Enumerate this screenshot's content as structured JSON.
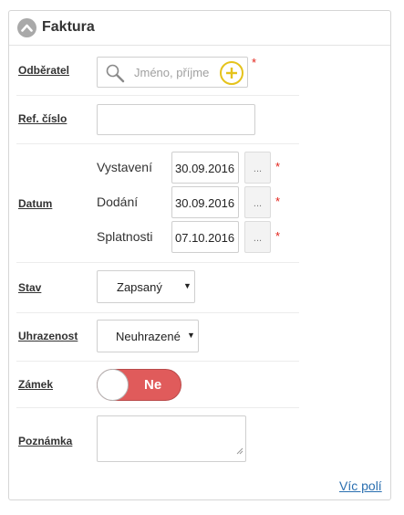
{
  "panel": {
    "title": "Faktura",
    "more_link": "Víc polí"
  },
  "fields": {
    "customer": {
      "label": "Odběratel",
      "placeholder": "Jméno, příjme",
      "required": "*"
    },
    "ref_number": {
      "label": "Ref. číslo",
      "value": ""
    },
    "date": {
      "label": "Datum",
      "rows": [
        {
          "label": "Vystavení",
          "value": "30.09.2016",
          "button": "...",
          "required": "*"
        },
        {
          "label": "Dodání",
          "value": "30.09.2016",
          "button": "...",
          "required": "*"
        },
        {
          "label": "Splatnosti",
          "value": "07.10.2016",
          "button": "...",
          "required": "*"
        }
      ]
    },
    "status": {
      "label": "Stav",
      "selected": "Zapsaný"
    },
    "payment": {
      "label": "Uhrazenost",
      "selected": "Neuhrazené"
    },
    "lock": {
      "label": "Zámek",
      "toggle_text": "Ne",
      "on": false
    },
    "note": {
      "label": "Poznámka",
      "value": ""
    }
  },
  "colors": {
    "required": "#e2231a",
    "toggle_off": "#e05b5b",
    "add_icon": "#e5c31c",
    "link": "#2a6fb0"
  },
  "icons": {
    "collapse": "chevron-up-icon",
    "search": "search-icon",
    "add": "plus-circle-icon",
    "dropdown": "caret-down-icon"
  }
}
